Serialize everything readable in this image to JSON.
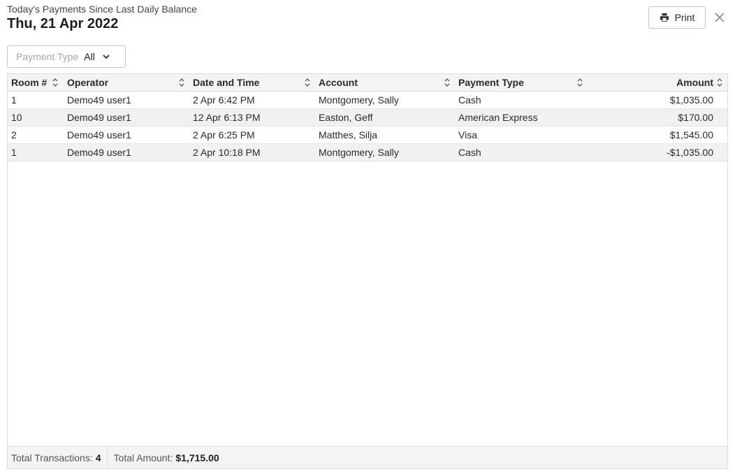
{
  "header": {
    "subtitle": "Today's Payments Since Last Daily Balance",
    "title": "Thu, 21 Apr 2022"
  },
  "toolbar": {
    "print_label": "Print",
    "print_icon": "printer-icon",
    "close_icon": "close-icon"
  },
  "filter": {
    "label": "Payment Type",
    "value": "All"
  },
  "table": {
    "columns": [
      "Room #",
      "Operator",
      "Date and Time",
      "Account",
      "Payment Type",
      "Amount"
    ],
    "rows": [
      {
        "room": "1",
        "operator": "Demo49 user1",
        "datetime": "2 Apr 6:42 PM",
        "account": "Montgomery, Sally",
        "payment_type": "Cash",
        "amount": "$1,035.00"
      },
      {
        "room": "10",
        "operator": "Demo49 user1",
        "datetime": "12 Apr 6:13 PM",
        "account": "Easton, Geff",
        "payment_type": "American Express",
        "amount": "$170.00"
      },
      {
        "room": "2",
        "operator": "Demo49 user1",
        "datetime": "2 Apr 6:25 PM",
        "account": "Matthes, Silja",
        "payment_type": "Visa",
        "amount": "$1,545.00"
      },
      {
        "room": "1",
        "operator": "Demo49 user1",
        "datetime": "2 Apr 10:18 PM",
        "account": "Montgomery, Sally",
        "payment_type": "Cash",
        "amount": "-$1,035.00"
      }
    ]
  },
  "footer": {
    "transactions_label": "Total Transactions:",
    "transactions_value": "4",
    "amount_label": "Total Amount:",
    "amount_value": "$1,715.00"
  }
}
